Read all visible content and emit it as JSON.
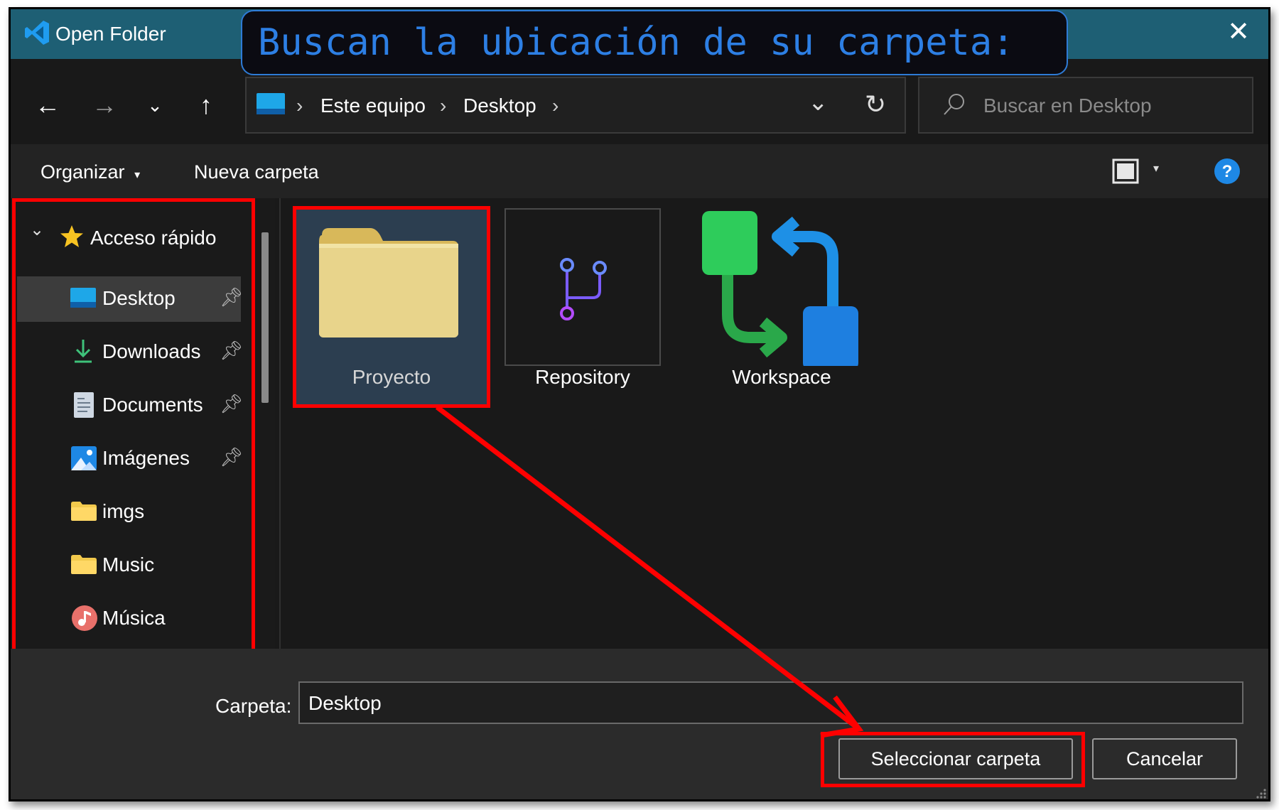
{
  "window": {
    "title": "Open Folder"
  },
  "callout": {
    "text": "Buscan la ubicación de su carpeta:"
  },
  "address_bar": {
    "segments": [
      "Este equipo",
      "Desktop"
    ]
  },
  "search": {
    "placeholder": "Buscar en Desktop"
  },
  "toolbar": {
    "organize_label": "Organizar",
    "new_folder_label": "Nueva carpeta"
  },
  "sidebar": {
    "quick_access_label": "Acceso rápido",
    "items": [
      {
        "label": "Desktop",
        "icon": "desktop-icon",
        "pinned": true,
        "selected": true
      },
      {
        "label": "Downloads",
        "icon": "download-icon",
        "pinned": true
      },
      {
        "label": "Documents",
        "icon": "document-icon",
        "pinned": true
      },
      {
        "label": "Imágenes",
        "icon": "pictures-icon",
        "pinned": true
      },
      {
        "label": "imgs",
        "icon": "folder-icon",
        "pinned": false
      },
      {
        "label": "Music",
        "icon": "folder-icon",
        "pinned": false
      },
      {
        "label": "Música",
        "icon": "music-icon",
        "pinned": false
      }
    ]
  },
  "files": [
    {
      "name": "Proyecto",
      "icon": "folder-icon",
      "selected": true
    },
    {
      "name": "Repository",
      "icon": "git-branch-icon"
    },
    {
      "name": "Workspace",
      "icon": "workspace-sync-icon"
    }
  ],
  "footer": {
    "folder_label": "Carpeta:",
    "folder_value": "Desktop",
    "select_button": "Seleccionar carpeta",
    "cancel_button": "Cancelar"
  },
  "colors": {
    "titlebar": "#1e5f74",
    "callout_text": "#2d7fe4",
    "highlight": "#ff0000",
    "selected_tile": "#2c3e50"
  }
}
